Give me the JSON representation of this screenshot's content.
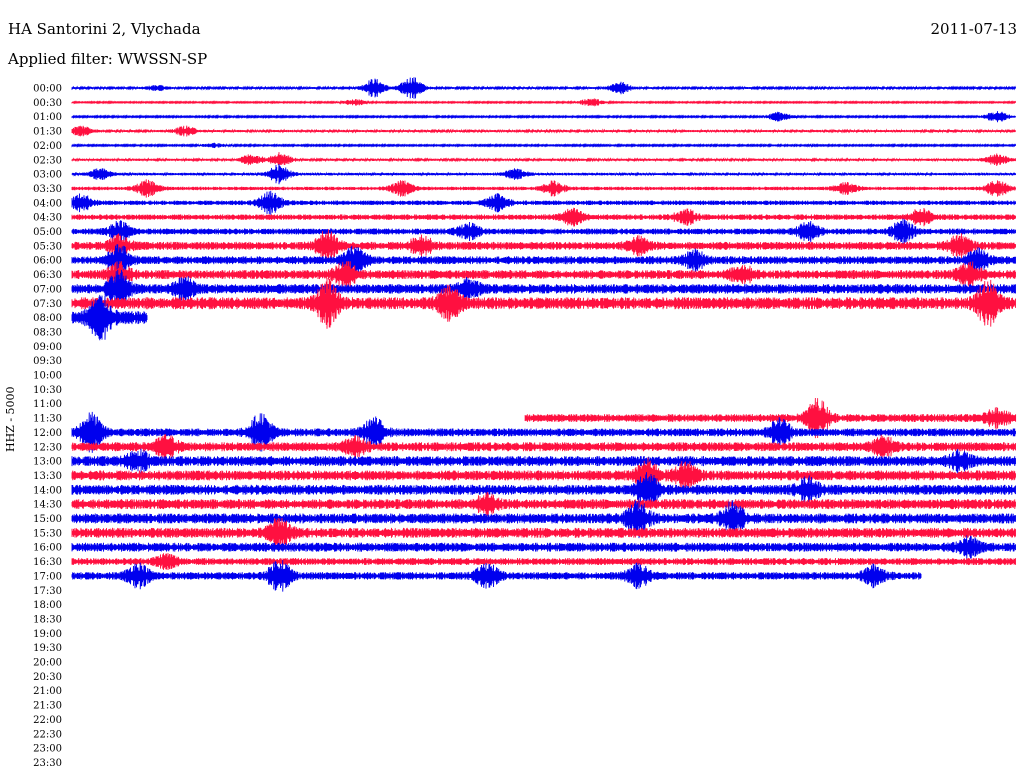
{
  "header": {
    "station": "HA Santorini 2, Vlychada",
    "date": "2011-07-13",
    "filter_text": "Applied filter: WWSSN-SP"
  },
  "chart_data": {
    "type": "line",
    "subtype": "helicorder",
    "ylabel": "HHZ - 5000",
    "row_labels": [
      "00:00",
      "00:30",
      "01:00",
      "01:30",
      "02:00",
      "02:30",
      "03:00",
      "03:30",
      "04:00",
      "04:30",
      "05:00",
      "05:30",
      "06:00",
      "06:30",
      "07:00",
      "07:30",
      "08:00",
      "08:30",
      "09:00",
      "09:30",
      "10:00",
      "10:30",
      "11:00",
      "11:30",
      "12:00",
      "12:30",
      "13:00",
      "13:30",
      "14:00",
      "14:30",
      "15:00",
      "15:30",
      "16:00",
      "16:30",
      "17:00",
      "17:30",
      "18:00",
      "18:30",
      "19:00",
      "19:30",
      "20:00",
      "20:30",
      "21:00",
      "21:30",
      "22:00",
      "22:30",
      "23:00",
      "23:30"
    ],
    "row_minutes": 30,
    "trace_colors": [
      "#0000ee",
      "#ff1040"
    ],
    "rows": [
      {
        "t": "00:00",
        "amp": 0.18,
        "end": 1.0,
        "events": [
          [
            0.09,
            0.5
          ],
          [
            0.32,
            1.8
          ],
          [
            0.36,
            2.2
          ],
          [
            0.58,
            1.2
          ]
        ]
      },
      {
        "t": "00:30",
        "amp": 0.12,
        "end": 1.0,
        "events": [
          [
            0.3,
            0.6
          ],
          [
            0.55,
            0.8
          ]
        ]
      },
      {
        "t": "01:00",
        "amp": 0.14,
        "end": 1.0,
        "events": [
          [
            0.75,
            0.9
          ],
          [
            0.98,
            1.1
          ]
        ]
      },
      {
        "t": "01:30",
        "amp": 0.22,
        "end": 1.0,
        "events": [
          [
            0.01,
            1.0
          ],
          [
            0.12,
            0.9
          ]
        ]
      },
      {
        "t": "02:00",
        "amp": 0.14,
        "end": 1.0,
        "events": [
          [
            0.15,
            0.4
          ]
        ]
      },
      {
        "t": "02:30",
        "amp": 0.22,
        "end": 1.0,
        "events": [
          [
            0.19,
            1.0
          ],
          [
            0.22,
            1.4
          ],
          [
            0.98,
            1.1
          ]
        ]
      },
      {
        "t": "03:00",
        "amp": 0.25,
        "end": 1.0,
        "events": [
          [
            0.03,
            1.0
          ],
          [
            0.22,
            1.8
          ],
          [
            0.47,
            1.0
          ]
        ]
      },
      {
        "t": "03:30",
        "amp": 0.35,
        "end": 1.0,
        "events": [
          [
            0.08,
            1.5
          ],
          [
            0.35,
            1.4
          ],
          [
            0.51,
            1.3
          ],
          [
            0.82,
            1.0
          ],
          [
            0.98,
            1.5
          ]
        ]
      },
      {
        "t": "04:00",
        "amp": 0.45,
        "end": 1.0,
        "events": [
          [
            0.01,
            1.5
          ],
          [
            0.21,
            2.0
          ],
          [
            0.45,
            1.7
          ]
        ]
      },
      {
        "t": "04:30",
        "amp": 0.55,
        "end": 1.0,
        "events": [
          [
            0.53,
            1.4
          ],
          [
            0.65,
            1.3
          ],
          [
            0.9,
            1.5
          ]
        ]
      },
      {
        "t": "05:00",
        "amp": 0.6,
        "end": 1.0,
        "events": [
          [
            0.05,
            1.8
          ],
          [
            0.42,
            1.4
          ],
          [
            0.78,
            1.6
          ],
          [
            0.88,
            2.0
          ]
        ]
      },
      {
        "t": "05:30",
        "amp": 0.8,
        "end": 1.0,
        "events": [
          [
            0.05,
            1.7
          ],
          [
            0.27,
            2.6
          ],
          [
            0.37,
            1.7
          ],
          [
            0.6,
            1.4
          ],
          [
            0.94,
            1.8
          ]
        ]
      },
      {
        "t": "06:00",
        "amp": 0.8,
        "end": 1.0,
        "events": [
          [
            0.05,
            2.6
          ],
          [
            0.3,
            2.4
          ],
          [
            0.66,
            1.6
          ],
          [
            0.96,
            1.9
          ]
        ]
      },
      {
        "t": "06:30",
        "amp": 0.9,
        "end": 1.0,
        "events": [
          [
            0.05,
            1.9
          ],
          [
            0.29,
            2.2
          ],
          [
            0.71,
            1.5
          ],
          [
            0.95,
            2.0
          ]
        ]
      },
      {
        "t": "07:00",
        "amp": 0.95,
        "end": 1.0,
        "events": [
          [
            0.05,
            3.2
          ],
          [
            0.12,
            1.8
          ],
          [
            0.42,
            1.5
          ]
        ]
      },
      {
        "t": "07:30",
        "amp": 1.2,
        "end": 1.0,
        "events": [
          [
            0.27,
            4.0
          ],
          [
            0.4,
            2.8
          ],
          [
            0.97,
            4.0
          ]
        ]
      },
      {
        "t": "08:00",
        "amp": 1.3,
        "end": 0.08,
        "events": [
          [
            0.03,
            3.8
          ]
        ]
      },
      {
        "t": "08:30",
        "amp": 0,
        "end": 0,
        "events": []
      },
      {
        "t": "09:00",
        "amp": 0,
        "end": 0,
        "events": []
      },
      {
        "t": "09:30",
        "amp": 0,
        "end": 0,
        "events": []
      },
      {
        "t": "10:00",
        "amp": 0,
        "end": 0,
        "events": []
      },
      {
        "t": "10:30",
        "amp": 0,
        "end": 0,
        "events": []
      },
      {
        "t": "11:00",
        "amp": 0,
        "end": 0,
        "events": []
      },
      {
        "t": "11:30",
        "amp": 0.8,
        "start": 0.48,
        "end": 1.0,
        "events": [
          [
            0.79,
            3.5
          ],
          [
            0.98,
            1.6
          ]
        ]
      },
      {
        "t": "12:00",
        "amp": 0.8,
        "end": 1.0,
        "events": [
          [
            0.02,
            3.5
          ],
          [
            0.2,
            3.5
          ],
          [
            0.32,
            2.5
          ],
          [
            0.75,
            2.4
          ]
        ]
      },
      {
        "t": "12:30",
        "amp": 0.9,
        "end": 1.0,
        "events": [
          [
            0.1,
            1.8
          ],
          [
            0.3,
            1.5
          ],
          [
            0.86,
            1.6
          ]
        ]
      },
      {
        "t": "13:00",
        "amp": 1.0,
        "end": 1.0,
        "events": [
          [
            0.07,
            1.8
          ],
          [
            0.94,
            1.6
          ]
        ]
      },
      {
        "t": "13:30",
        "amp": 1.0,
        "end": 1.0,
        "events": [
          [
            0.61,
            2.6
          ],
          [
            0.65,
            2.2
          ]
        ]
      },
      {
        "t": "14:00",
        "amp": 1.0,
        "end": 1.0,
        "events": [
          [
            0.61,
            2.8
          ],
          [
            0.78,
            2.0
          ]
        ]
      },
      {
        "t": "14:30",
        "amp": 1.0,
        "end": 1.0,
        "events": [
          [
            0.44,
            1.6
          ]
        ]
      },
      {
        "t": "15:00",
        "amp": 1.0,
        "end": 1.0,
        "events": [
          [
            0.6,
            3.0
          ],
          [
            0.7,
            2.8
          ]
        ]
      },
      {
        "t": "15:30",
        "amp": 1.0,
        "end": 1.0,
        "events": [
          [
            0.22,
            2.5
          ]
        ]
      },
      {
        "t": "16:00",
        "amp": 0.9,
        "end": 1.0,
        "events": [
          [
            0.95,
            1.6
          ]
        ]
      },
      {
        "t": "16:30",
        "amp": 0.7,
        "end": 1.0,
        "events": [
          [
            0.1,
            1.2
          ]
        ]
      },
      {
        "t": "17:00",
        "amp": 0.75,
        "end": 0.9,
        "events": [
          [
            0.07,
            2.2
          ],
          [
            0.22,
            3.0
          ],
          [
            0.44,
            2.2
          ],
          [
            0.6,
            2.0
          ],
          [
            0.85,
            1.8
          ]
        ]
      },
      {
        "t": "17:30",
        "amp": 0,
        "end": 0,
        "events": []
      },
      {
        "t": "18:00",
        "amp": 0,
        "end": 0,
        "events": []
      },
      {
        "t": "18:30",
        "amp": 0,
        "end": 0,
        "events": []
      },
      {
        "t": "19:00",
        "amp": 0,
        "end": 0,
        "events": []
      },
      {
        "t": "19:30",
        "amp": 0,
        "end": 0,
        "events": []
      },
      {
        "t": "20:00",
        "amp": 0,
        "end": 0,
        "events": []
      },
      {
        "t": "20:30",
        "amp": 0,
        "end": 0,
        "events": []
      },
      {
        "t": "21:00",
        "amp": 0,
        "end": 0,
        "events": []
      },
      {
        "t": "21:30",
        "amp": 0,
        "end": 0,
        "events": []
      },
      {
        "t": "22:00",
        "amp": 0,
        "end": 0,
        "events": []
      },
      {
        "t": "22:30",
        "amp": 0,
        "end": 0,
        "events": []
      },
      {
        "t": "23:00",
        "amp": 0,
        "end": 0,
        "events": []
      },
      {
        "t": "23:30",
        "amp": 0,
        "end": 0,
        "events": []
      }
    ]
  }
}
